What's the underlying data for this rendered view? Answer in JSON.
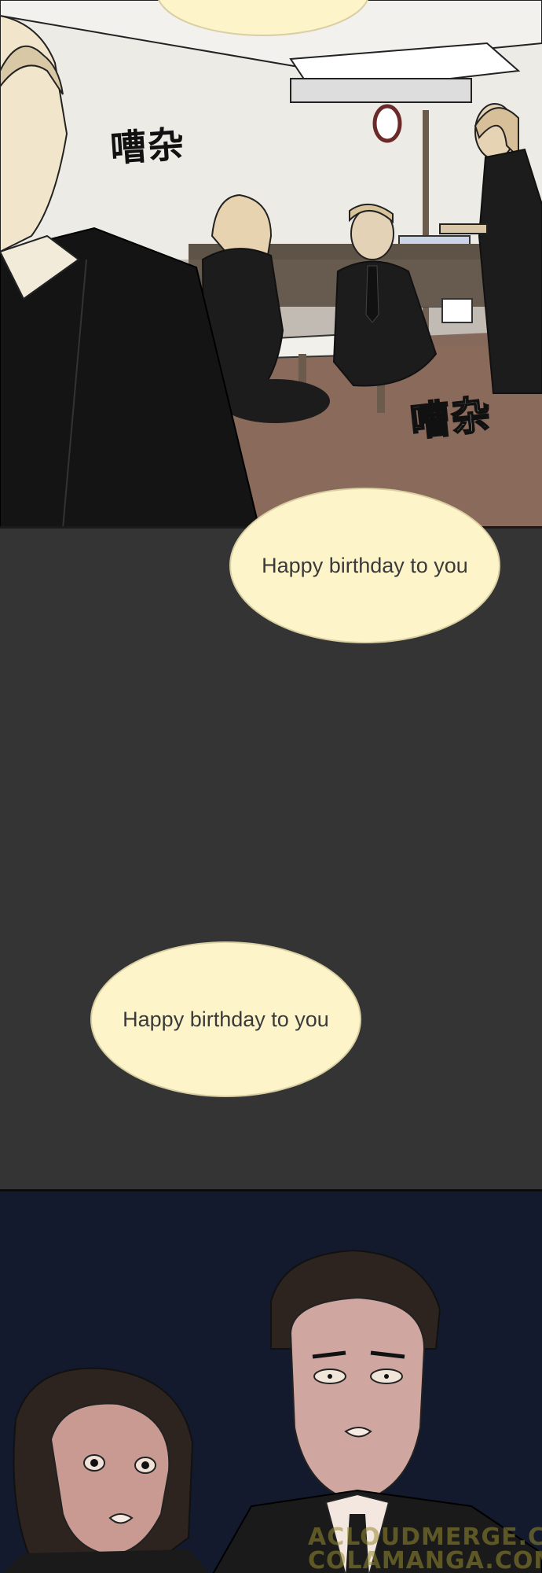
{
  "panels": {
    "top": {
      "sfx_left": "嘈杂",
      "sfx_right": "嘈杂"
    },
    "dark": {
      "bubble_1": "Happy birthday to you",
      "bubble_2": "Happy birthday to you"
    },
    "bottom": {
      "watermark_1": "ACLOUDMERGE.COM",
      "watermark_2": "COLAMANGA.COM"
    }
  },
  "colors": {
    "bubble_fill": "#fdf5c9",
    "dark_panel": "#343434",
    "night_panel": "#141a2d"
  }
}
